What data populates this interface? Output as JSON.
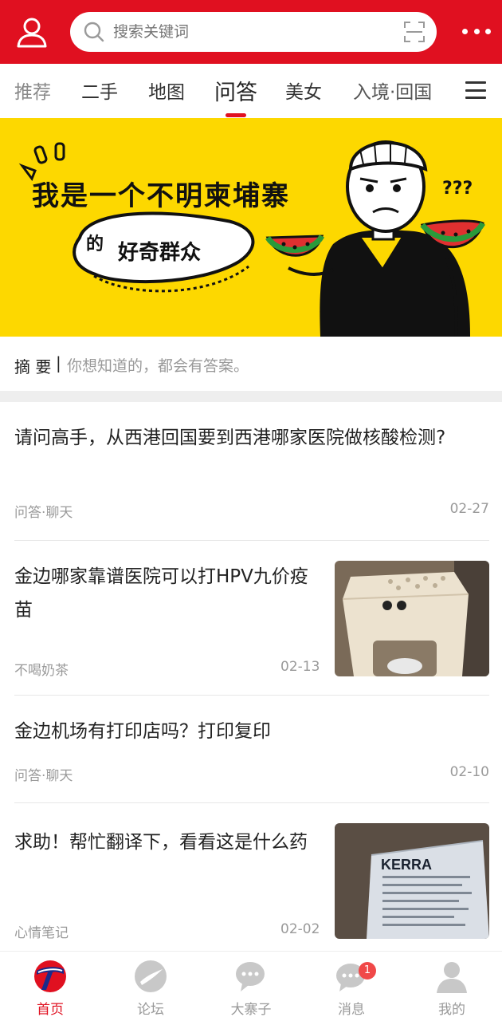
{
  "header": {
    "search_placeholder": "搜索关键词",
    "icons": [
      "user-icon",
      "search-icon",
      "scan-icon",
      "more-icon"
    ],
    "brand_color": "#e01020"
  },
  "tabs": [
    {
      "label": "推荐"
    },
    {
      "label": "二手"
    },
    {
      "label": "地图"
    },
    {
      "label": "问答",
      "active": true
    },
    {
      "label": "美女"
    },
    {
      "label": "入境·回国"
    }
  ],
  "banner": {
    "line1": "我是一个不明柬埔寨",
    "line2_small": "的",
    "line2": "好奇群众",
    "marks": "???",
    "background": "#fdd800"
  },
  "summary": {
    "label": "摘 要",
    "separator": "|",
    "text": "你想知道的，都会有答案。"
  },
  "feed": [
    {
      "title": "请问高手，从西港回国要到西港哪家医院做核酸检测?",
      "category": "问答·聊天",
      "date": "02-27",
      "has_image": false
    },
    {
      "title": "金边哪家靠谱医院可以打HPV九价疫苗",
      "category": "不喝奶茶",
      "date": "02-13",
      "has_image": true,
      "image": "stool-with-cat"
    },
    {
      "title": "金边机场有打印店吗？打印复印",
      "category": "问答·聊天",
      "date": "02-10",
      "has_image": false
    },
    {
      "title": "求助！帮忙翻译下，看看这是什么药",
      "category": "心情笔记",
      "date": "02-02",
      "has_image": true,
      "image": "kerra-medicine-pack",
      "image_text": "KERRA"
    }
  ],
  "bottom_nav": [
    {
      "label": "首页",
      "icon": "home-logo-icon",
      "active": true
    },
    {
      "label": "论坛",
      "icon": "forum-icon"
    },
    {
      "label": "大寨子",
      "icon": "chat-bubbles-icon"
    },
    {
      "label": "消息",
      "icon": "message-icon",
      "badge": "1"
    },
    {
      "label": "我的",
      "icon": "profile-icon"
    }
  ]
}
